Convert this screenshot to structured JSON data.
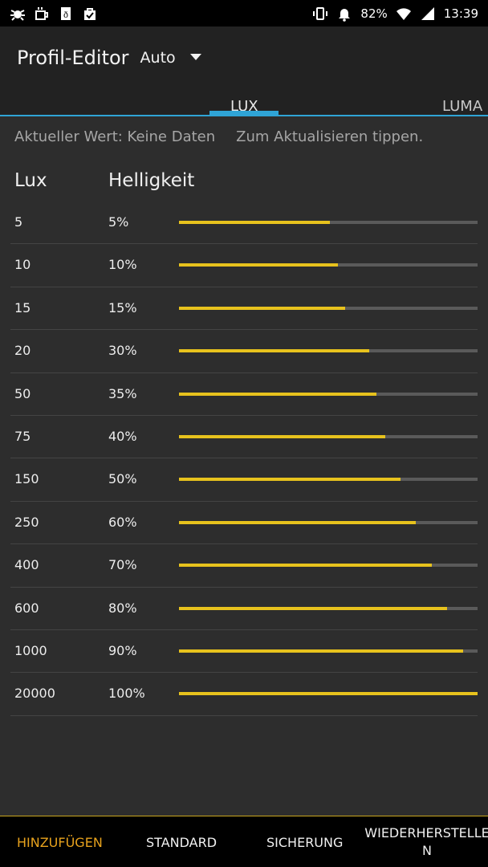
{
  "status_bar": {
    "icons_left": [
      "bug-icon",
      "mug-icon",
      "theme-icon",
      "shopping-bag-icon"
    ],
    "icons_right": [
      "vibrate-icon",
      "alarm-icon",
      "wifi-icon",
      "signal-icon"
    ],
    "battery": "82%",
    "time": "13:39"
  },
  "toolbar": {
    "title": "Profil-Editor",
    "mode_value": "Auto"
  },
  "tabs": [
    {
      "label": "LUX",
      "active": true
    },
    {
      "label": "LUMA",
      "active": false
    }
  ],
  "info": {
    "current_value": "Aktueller Wert: Keine Daten",
    "refresh_hint": "Zum Aktualisieren tippen."
  },
  "table": {
    "headers": {
      "lux": "Lux",
      "brightness": "Helligkeit"
    },
    "rows": [
      {
        "lux": "5",
        "brightness": "5%",
        "level": 0.506
      },
      {
        "lux": "10",
        "brightness": "10%",
        "level": 0.532
      },
      {
        "lux": "15",
        "brightness": "15%",
        "level": 0.556
      },
      {
        "lux": "20",
        "brightness": "30%",
        "level": 0.637
      },
      {
        "lux": "50",
        "brightness": "35%",
        "level": 0.661
      },
      {
        "lux": "75",
        "brightness": "40%",
        "level": 0.691
      },
      {
        "lux": "150",
        "brightness": "50%",
        "level": 0.742
      },
      {
        "lux": "250",
        "brightness": "60%",
        "level": 0.793
      },
      {
        "lux": "400",
        "brightness": "70%",
        "level": 0.847
      },
      {
        "lux": "600",
        "brightness": "80%",
        "level": 0.898
      },
      {
        "lux": "1000",
        "brightness": "90%",
        "level": 0.952
      },
      {
        "lux": "20000",
        "brightness": "100%",
        "level": 1.0
      }
    ]
  },
  "bottom_bar": {
    "add": "HINZUFÜGEN",
    "default": "STANDARD",
    "backup": "SICHERUNG",
    "restore": "WIEDERHERSTELLE N"
  },
  "colors": {
    "accent_yellow": "#e7c21d",
    "accent_orange": "#e7a21d",
    "tab_blue": "#2fa4d6"
  }
}
